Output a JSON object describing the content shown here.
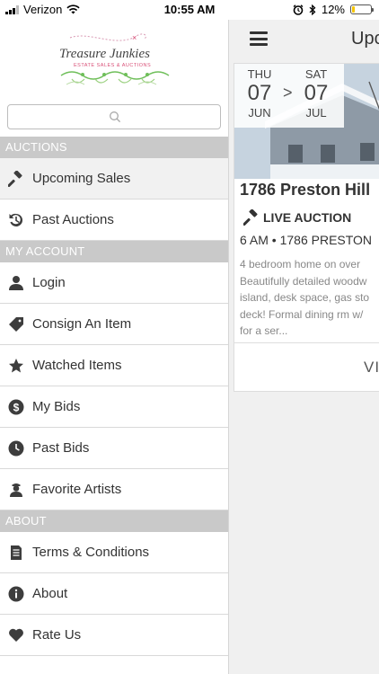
{
  "status_bar": {
    "carrier": "Verizon",
    "time": "10:55 AM",
    "battery_percent": "12%"
  },
  "sidebar": {
    "brand": {
      "name": "Treasure Junkies",
      "tagline": "ESTATE SALES & AUCTIONS"
    },
    "search": {
      "placeholder": ""
    },
    "sections": [
      {
        "title": "AUCTIONS",
        "items": [
          {
            "label": "Upcoming Sales",
            "icon": "gavel-icon",
            "active": true
          },
          {
            "label": "Past Auctions",
            "icon": "history-icon"
          }
        ]
      },
      {
        "title": "MY ACCOUNT",
        "items": [
          {
            "label": "Login",
            "icon": "user-icon"
          },
          {
            "label": "Consign An Item",
            "icon": "tag-icon"
          },
          {
            "label": "Watched Items",
            "icon": "star-icon"
          },
          {
            "label": "My Bids",
            "icon": "dollar-icon"
          },
          {
            "label": "Past Bids",
            "icon": "clock-icon"
          },
          {
            "label": "Favorite Artists",
            "icon": "artist-icon"
          }
        ]
      },
      {
        "title": "ABOUT",
        "items": [
          {
            "label": "Terms & Conditions",
            "icon": "document-icon"
          },
          {
            "label": "About",
            "icon": "info-icon"
          },
          {
            "label": "Rate Us",
            "icon": "heart-icon"
          }
        ]
      }
    ]
  },
  "main": {
    "title": "Upco",
    "card": {
      "start": {
        "weekday": "THU",
        "day": "07",
        "month": "JUN"
      },
      "separator": ">",
      "end": {
        "weekday": "SAT",
        "day": "07",
        "month": "JUL"
      },
      "title": "1786 Preston Hill",
      "type_label": "LIVE AUCTION",
      "time_location": "6 AM • 1786 PRESTON",
      "description_lines": [
        "4 bedroom home on over",
        "Beautifully detailed woodw",
        "island, desk space, gas sto",
        "deck! Formal dining rm w/",
        "for a ser..."
      ],
      "view_label": "VI"
    }
  },
  "colors": {
    "section_bg": "#c9c9c9",
    "text": "#333333",
    "main_bg": "#f0f0f0",
    "battery": "#f5c400"
  }
}
